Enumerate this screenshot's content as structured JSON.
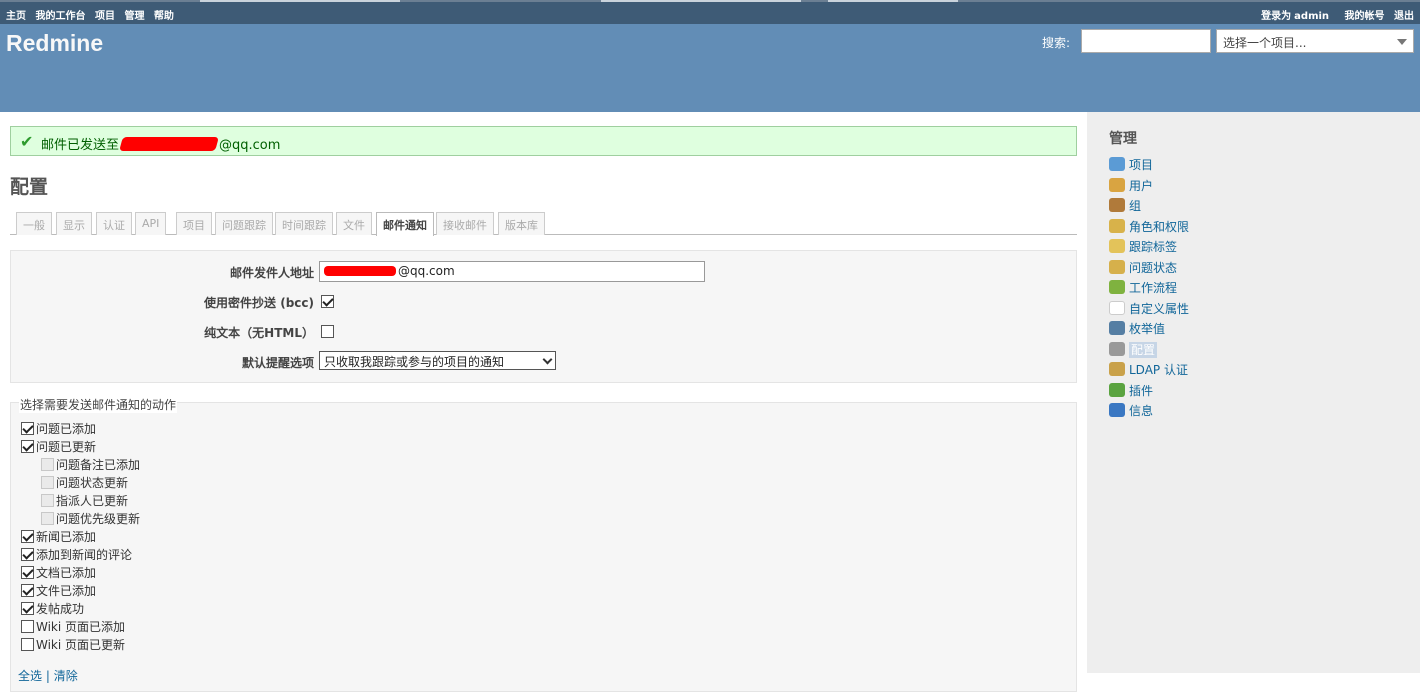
{
  "top_menu": {
    "left": [
      "主页",
      "我的工作台",
      "项目",
      "管理",
      "帮助"
    ],
    "logged_in_prefix": "登录为",
    "logged_in_user": "admin",
    "my_account": "我的帐号",
    "logout": "退出"
  },
  "header": {
    "title": "Redmine",
    "search_label": "搜索:",
    "project_jump": "选择一个项目..."
  },
  "flash": {
    "prefix": "邮件已发送至",
    "suffix": "@qq.com"
  },
  "page_title": "配置",
  "tabs": [
    "一般",
    "显示",
    "认证",
    "API",
    "项目",
    "问题跟踪",
    "时间跟踪",
    "文件",
    "邮件通知",
    "接收邮件",
    "版本库"
  ],
  "selected_tab": "邮件通知",
  "settings": {
    "from_label": "邮件发件人地址",
    "from_value_suffix": "@qq.com",
    "bcc_label": "使用密件抄送 (bcc)",
    "bcc_checked": true,
    "plain_text_label": "纯文本（无HTML）",
    "plain_text_checked": false,
    "default_notify_label": "默认提醒选项",
    "default_notify_value": "只收取我跟踪或参与的项目的通知"
  },
  "actions": {
    "legend": "选择需要发送邮件通知的动作",
    "items": [
      {
        "label": "问题已添加",
        "checked": true,
        "sub": false,
        "disabled": false
      },
      {
        "label": "问题已更新",
        "checked": true,
        "sub": false,
        "disabled": false
      },
      {
        "label": "问题备注已添加",
        "checked": false,
        "sub": true,
        "disabled": true
      },
      {
        "label": "问题状态更新",
        "checked": false,
        "sub": true,
        "disabled": true
      },
      {
        "label": "指派人已更新",
        "checked": false,
        "sub": true,
        "disabled": true
      },
      {
        "label": "问题优先级更新",
        "checked": false,
        "sub": true,
        "disabled": true
      },
      {
        "label": "新闻已添加",
        "checked": true,
        "sub": false,
        "disabled": false
      },
      {
        "label": "添加到新闻的评论",
        "checked": true,
        "sub": false,
        "disabled": false
      },
      {
        "label": "文档已添加",
        "checked": true,
        "sub": false,
        "disabled": false
      },
      {
        "label": "文件已添加",
        "checked": true,
        "sub": false,
        "disabled": false
      },
      {
        "label": "发帖成功",
        "checked": true,
        "sub": false,
        "disabled": false
      },
      {
        "label": "Wiki 页面已添加",
        "checked": false,
        "sub": false,
        "disabled": false
      },
      {
        "label": "Wiki 页面已更新",
        "checked": false,
        "sub": false,
        "disabled": false
      }
    ],
    "check_all": "全选",
    "separator": "|",
    "clear": "清除"
  },
  "sidebar": {
    "title": "管理",
    "items": [
      {
        "label": "项目",
        "icon": "projects-icon",
        "color": "#5b9bd5"
      },
      {
        "label": "用户",
        "icon": "user-icon",
        "color": "#d9a441"
      },
      {
        "label": "组",
        "icon": "group-icon",
        "color": "#b07a3a"
      },
      {
        "label": "角色和权限",
        "icon": "roles-icon",
        "color": "#d8b24a"
      },
      {
        "label": "跟踪标签",
        "icon": "tracker-icon",
        "color": "#e3c35a"
      },
      {
        "label": "问题状态",
        "icon": "issue-status-icon",
        "color": "#d6b04b"
      },
      {
        "label": "工作流程",
        "icon": "workflow-icon",
        "color": "#7fb23f"
      },
      {
        "label": "自定义属性",
        "icon": "custom-fields-icon",
        "color": "#ffffff"
      },
      {
        "label": "枚举值",
        "icon": "enumerations-icon",
        "color": "#557ea3"
      },
      {
        "label": "配置",
        "icon": "settings-gear-icon",
        "color": "#999999"
      },
      {
        "label": "LDAP 认证",
        "icon": "ldap-icon",
        "color": "#c9a14a"
      },
      {
        "label": "插件",
        "icon": "plugin-icon",
        "color": "#5aa340"
      },
      {
        "label": "信息",
        "icon": "info-icon",
        "color": "#3a77c2"
      }
    ],
    "selected": "配置"
  }
}
